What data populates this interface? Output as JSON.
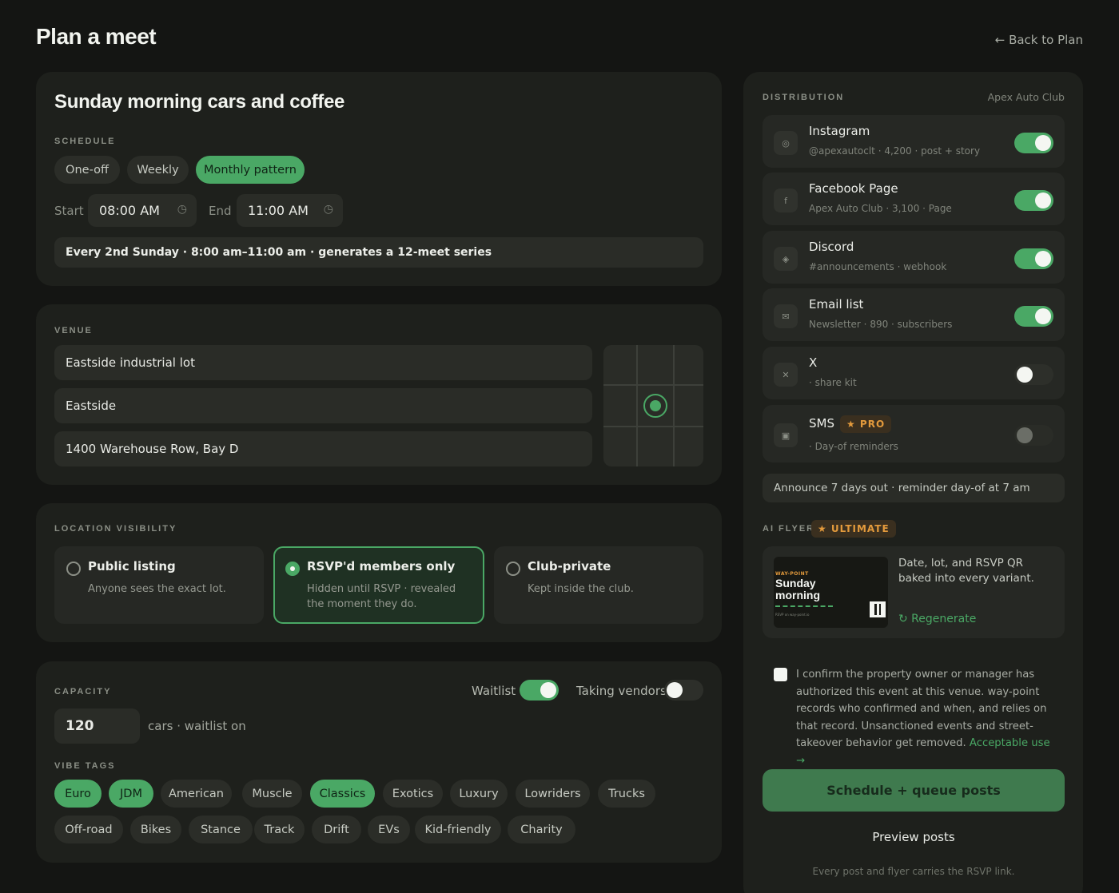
{
  "header": {
    "title": "Plan a meet",
    "back_label": "← Back to Plan"
  },
  "meet": {
    "title": "Sunday morning cars and coffee"
  },
  "schedule": {
    "label": "SCHEDULE",
    "options": [
      "One-off",
      "Weekly",
      "Monthly pattern"
    ],
    "selected": "Monthly pattern",
    "start_label": "Start",
    "start_value": "08:00 AM",
    "end_label": "End",
    "end_value": "11:00 AM",
    "summary": "Every 2nd Sunday · 8:00 am–11:00 am · generates a 12-meet series"
  },
  "venue": {
    "label": "VENUE",
    "name": "Eastside industrial lot",
    "area": "Eastside",
    "address": "1400 Warehouse Row, Bay D"
  },
  "visibility": {
    "label": "LOCATION VISIBILITY",
    "options": [
      {
        "title": "Public listing",
        "desc": "Anyone sees the exact lot."
      },
      {
        "title": "RSVP'd members only",
        "desc": "Hidden until RSVP · revealed the moment they do."
      },
      {
        "title": "Club-private",
        "desc": "Kept inside the club."
      }
    ],
    "selected": 1
  },
  "capacity": {
    "label": "CAPACITY",
    "value": "120",
    "suffix": "cars · waitlist on",
    "waitlist_label": "Waitlist",
    "waitlist_on": true,
    "vendors_label": "Taking vendors",
    "vendors_on": false
  },
  "vibe": {
    "label": "VIBE TAGS",
    "row1": [
      "Euro",
      "JDM",
      "American",
      "Muscle",
      "Classics",
      "Exotics",
      "Luxury",
      "Lowriders",
      "Trucks"
    ],
    "row2": [
      "Off-road",
      "Bikes",
      "Stance",
      "Track",
      "Drift",
      "EVs",
      "Kid-friendly",
      "Charity"
    ],
    "active": [
      "Euro",
      "JDM",
      "Classics"
    ]
  },
  "distribution": {
    "label": "DISTRIBUTION",
    "club": "Apex Auto Club",
    "channels": [
      {
        "name": "Instagram",
        "sub": "@apexautoclt · 4,200 · post + story",
        "icon": "◎",
        "on": true
      },
      {
        "name": "Facebook Page",
        "sub": "Apex Auto Club · 3,100 · Page",
        "icon": "f",
        "on": true
      },
      {
        "name": "Discord",
        "sub": "#announcements · webhook",
        "icon": "◈",
        "on": true
      },
      {
        "name": "Email list",
        "sub": "Newsletter · 890 · subscribers",
        "icon": "✉",
        "on": true
      },
      {
        "name": "X",
        "sub": "· share kit",
        "icon": "✕",
        "on": false
      },
      {
        "name": "SMS",
        "sub": "· Day-of reminders",
        "icon": "▣",
        "on": false,
        "badge": "★ PRO"
      }
    ],
    "announce": "Announce 7 days out · reminder day-of at 7 am"
  },
  "flyer": {
    "label": "AI FLYER",
    "badge": "★ ULTIMATE",
    "thumb_brand": "WAY-POINT",
    "thumb_title": "Sunday morning",
    "thumb_small": "RSVP on way-point.io",
    "desc": "Date, lot, and RSVP QR baked into every variant.",
    "regenerate": "↻ Regenerate"
  },
  "confirm": {
    "text": "I confirm the property owner or manager has authorized this event at this venue. way-point records who confirmed and when, and relies on that record. Unsanctioned events and street-takeover behavior get removed.",
    "link": "Acceptable use →"
  },
  "actions": {
    "primary": "Schedule + queue posts",
    "secondary": "Preview posts",
    "footnote": "Every post and flyer carries the RSVP link."
  },
  "colors": {
    "accent": "#4aa865",
    "pro": "#e39a3c",
    "background": "#141513",
    "panel": "#1e201c"
  }
}
